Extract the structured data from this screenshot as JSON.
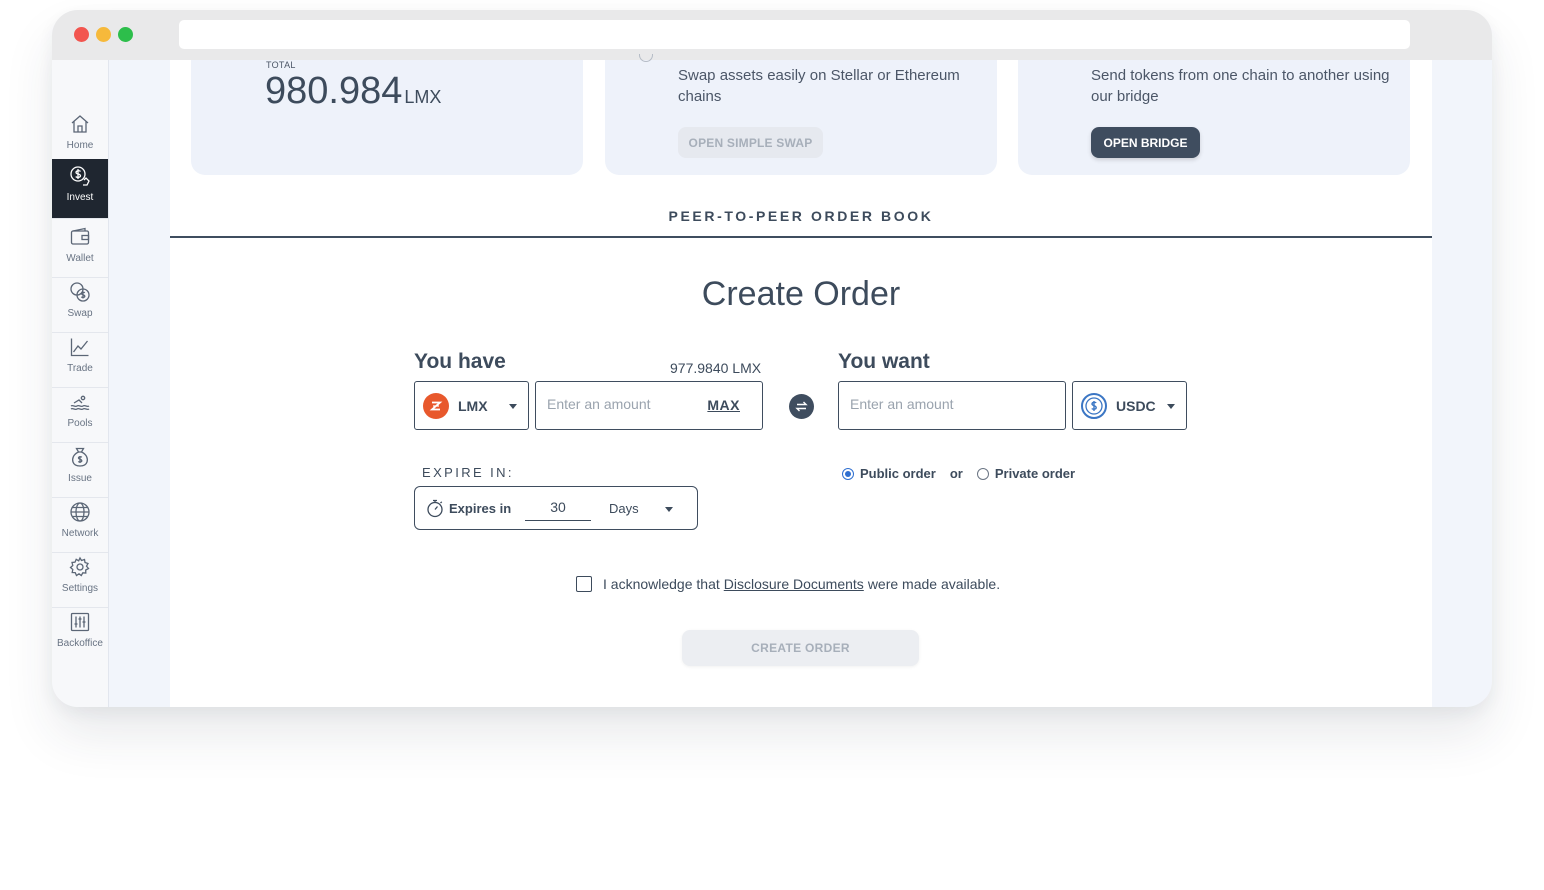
{
  "sidebar": {
    "items": [
      {
        "label": "Home",
        "icon": "home-icon",
        "active": false
      },
      {
        "label": "Invest",
        "icon": "invest-icon",
        "active": true
      },
      {
        "label": "Wallet",
        "icon": "wallet-icon",
        "active": false
      },
      {
        "label": "Swap",
        "icon": "swap-coins-icon",
        "active": false
      },
      {
        "label": "Trade",
        "icon": "chart-icon",
        "active": false
      },
      {
        "label": "Pools",
        "icon": "pools-icon",
        "active": false
      },
      {
        "label": "Issue",
        "icon": "money-bag-icon",
        "active": false
      },
      {
        "label": "Network",
        "icon": "globe-icon",
        "active": false
      },
      {
        "label": "Settings",
        "icon": "gear-icon",
        "active": false
      },
      {
        "label": "Backoffice",
        "icon": "sliders-icon",
        "active": false
      }
    ]
  },
  "cards": {
    "total": {
      "label": "TOTAL",
      "value": "980.984",
      "unit": "LMX"
    },
    "swap": {
      "text": "Swap assets easily on Stellar or Ethereum chains",
      "button": "OPEN SIMPLE SWAP"
    },
    "bridge": {
      "text": "Send tokens from one chain to another using our bridge",
      "button": "OPEN BRIDGE"
    }
  },
  "order_book": {
    "title": "PEER-TO-PEER ORDER BOOK"
  },
  "create_order": {
    "title": "Create Order",
    "you_have": {
      "label": "You have",
      "balance": "977.9840 LMX",
      "token": "LMX",
      "placeholder": "Enter an amount",
      "max": "MAX"
    },
    "you_want": {
      "label": "You want",
      "token": "USDC",
      "placeholder": "Enter an amount"
    },
    "expire": {
      "label": "EXPIRE IN:",
      "text": "Expires in",
      "value": "30",
      "unit": "Days"
    },
    "visibility": {
      "public": "Public order",
      "or": "or",
      "private": "Private order",
      "selected": "public"
    },
    "ack": {
      "before": "I acknowledge that",
      "link": "Disclosure Documents",
      "after": "were made available."
    },
    "submit": "CREATE ORDER"
  },
  "colors": {
    "accent_dark": "#3f4d5f",
    "active_nav": "#1f2630",
    "lmx": "#e8582c",
    "usdc": "#3b76c4"
  }
}
